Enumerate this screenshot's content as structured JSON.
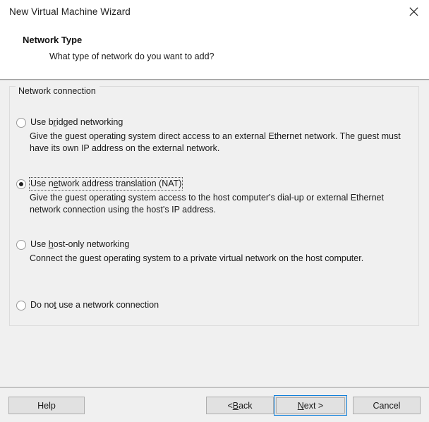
{
  "window": {
    "title": "New Virtual Machine Wizard",
    "close_icon": "close-x-icon"
  },
  "header": {
    "title": "Network Type",
    "subtitle": "What type of network do you want to add?"
  },
  "group": {
    "legend": "Network connection",
    "options": [
      {
        "label_before": "Use b",
        "accel": "r",
        "label_after": "idged networking",
        "full_label": "Use bridged networking",
        "description": "Give the guest operating system direct access to an external Ethernet network. The guest must have its own IP address on the external network.",
        "selected": false,
        "focused": false
      },
      {
        "label_before": "Use n",
        "accel": "e",
        "label_after": "twork address translation (NAT)",
        "full_label": "Use network address translation (NAT)",
        "description": "Give the guest operating system access to the host computer's dial-up or external Ethernet network connection using the host's IP address.",
        "selected": true,
        "focused": true
      },
      {
        "label_before": "Use ",
        "accel": "h",
        "label_after": "ost-only networking",
        "full_label": "Use host-only networking",
        "description": "Connect the guest operating system to a private virtual network on the host computer.",
        "selected": false,
        "focused": false
      },
      {
        "label_before": "Do no",
        "accel": "t",
        "label_after": " use a network connection",
        "full_label": "Do not use a network connection",
        "description": "",
        "selected": false,
        "focused": false
      }
    ]
  },
  "footer": {
    "help": "Help",
    "back_before": "< ",
    "back_accel": "B",
    "back_after": "ack",
    "next_before": "",
    "next_accel": "N",
    "next_after": "ext >",
    "cancel": "Cancel"
  },
  "colors": {
    "default_button_border": "#0f7fda",
    "button_face": "#e1e1e1",
    "button_border": "#adadad",
    "dialog_background": "#f0f0f0",
    "header_background": "#ffffff"
  }
}
